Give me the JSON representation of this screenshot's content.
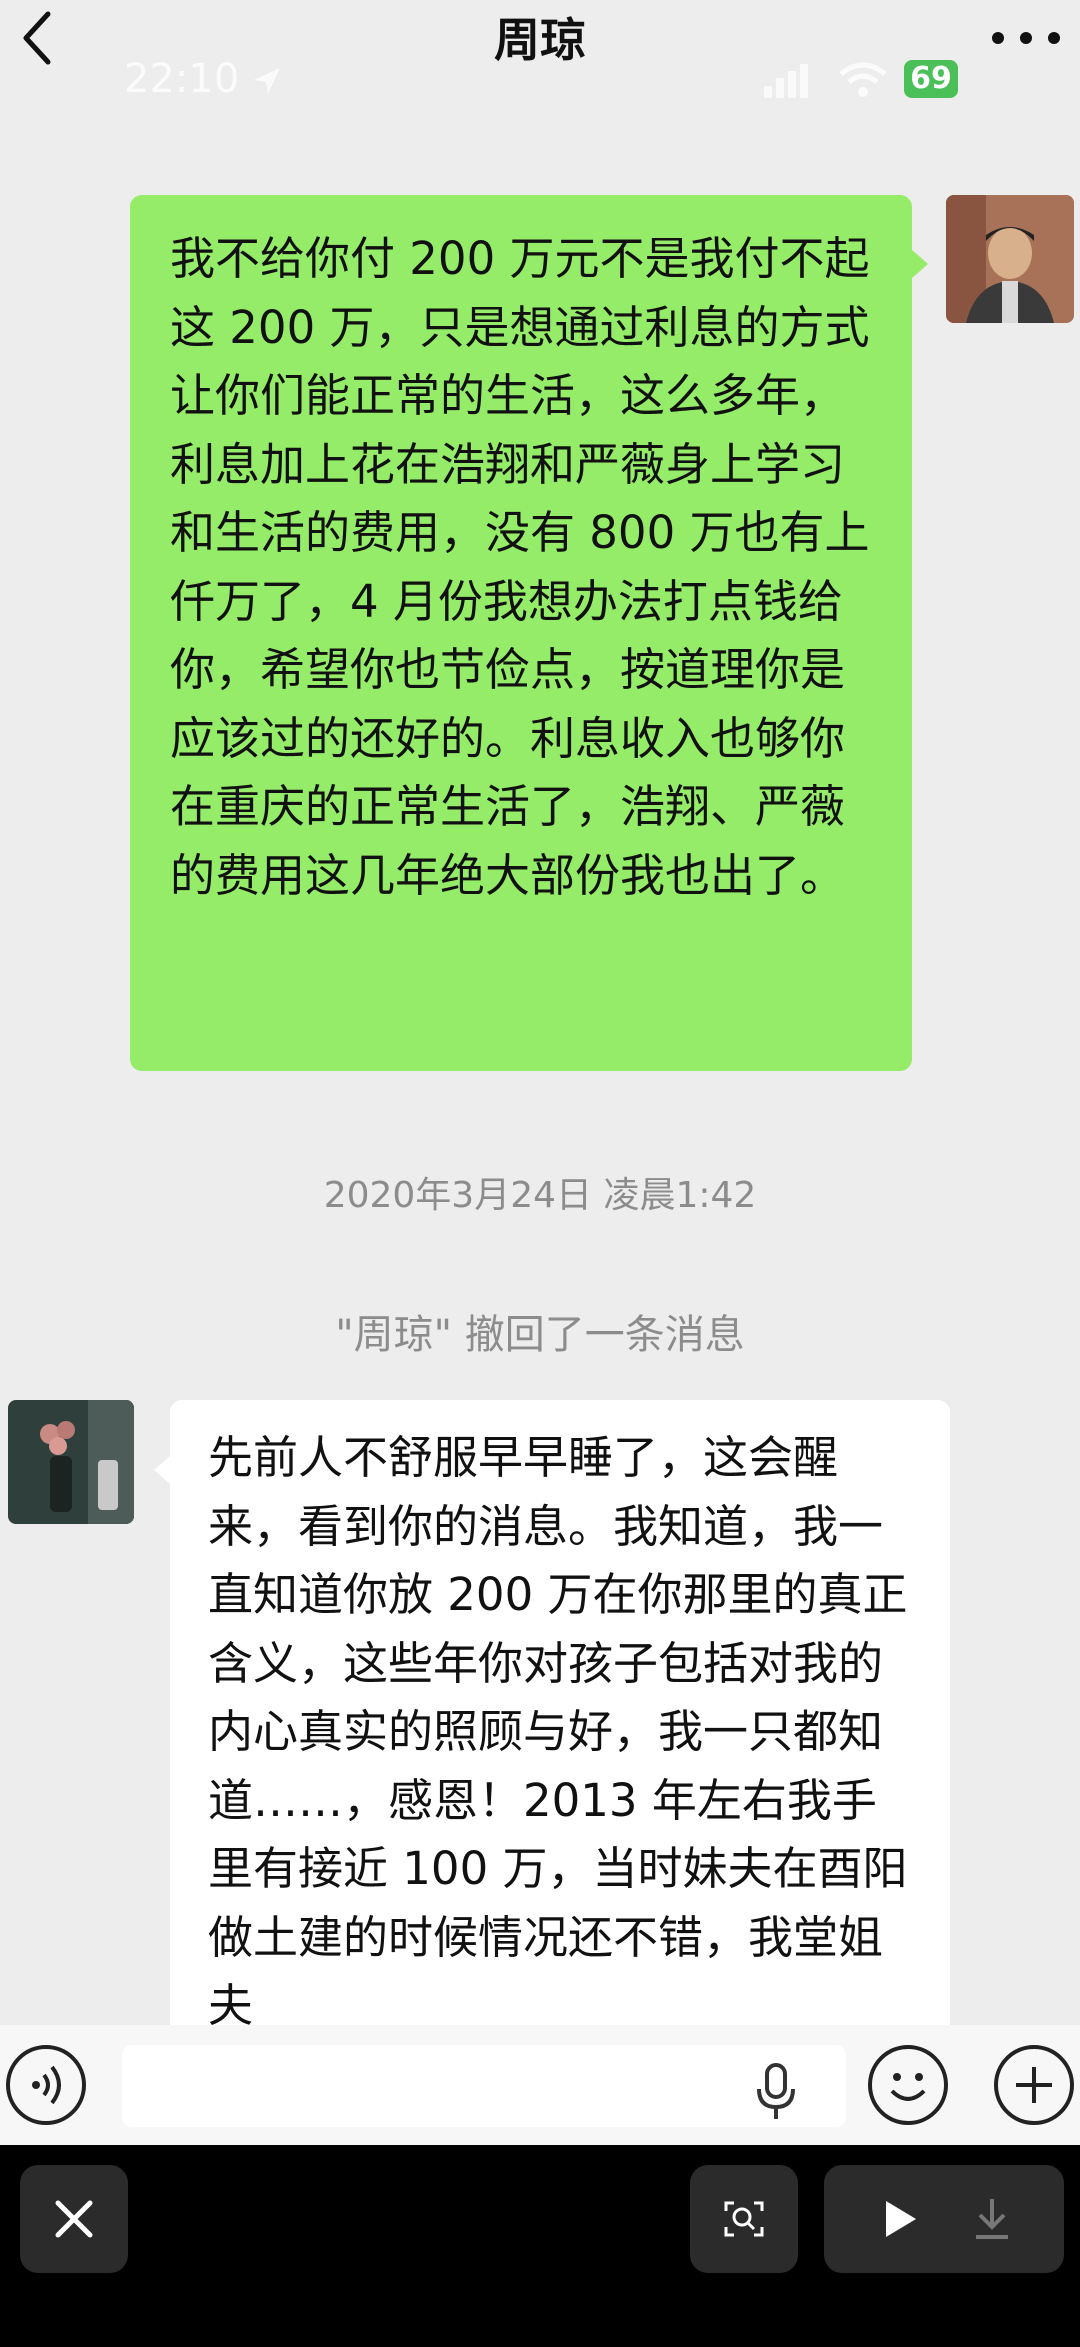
{
  "header": {
    "title": "周琼",
    "status_time": "22:10",
    "battery": "69"
  },
  "messages": {
    "outgoing_text": "我不给你付 200 万元不是我付不起这 200 万，只是想通过利息的方式让你们能正常的生活，这么多年，利息加上花在浩翔和严薇身上学习和生活的费用，没有 800 万也有上仟万了，4 月份我想办法打点钱给你，希望你也节俭点，按道理你是应该过的还好的。利息收入也够你在重庆的正常生活了，浩翔、严薇的费用这几年绝大部份我也出了。",
    "timestamp": "2020年3月24日 凌晨1:42",
    "recall_notice": "\"周琼\" 撤回了一条消息",
    "incoming_text": "先前人不舒服早早睡了，这会醒来，看到你的消息。我知道，我一直知道你放 200 万在你那里的真正含义，这些年你对孩子包括对我的内心真实的照顾与好，我一只都知道……，感恩！2013 年左右我手里有接近 100 万，当时妹夫在酉阳做土建的时候情况还不错，我堂姐夫"
  },
  "icons": {
    "back": "chevron-left-icon",
    "more": "more-dots-icon",
    "voice": "voice-icon",
    "mic": "microphone-icon",
    "emoji": "emoji-icon",
    "plus": "plus-icon",
    "close": "close-icon",
    "scan": "scan-icon",
    "play": "play-icon",
    "download": "download-icon"
  },
  "colors": {
    "outgoing_bubble": "#95ec69",
    "incoming_bubble": "#ffffff",
    "background": "#ededed"
  }
}
